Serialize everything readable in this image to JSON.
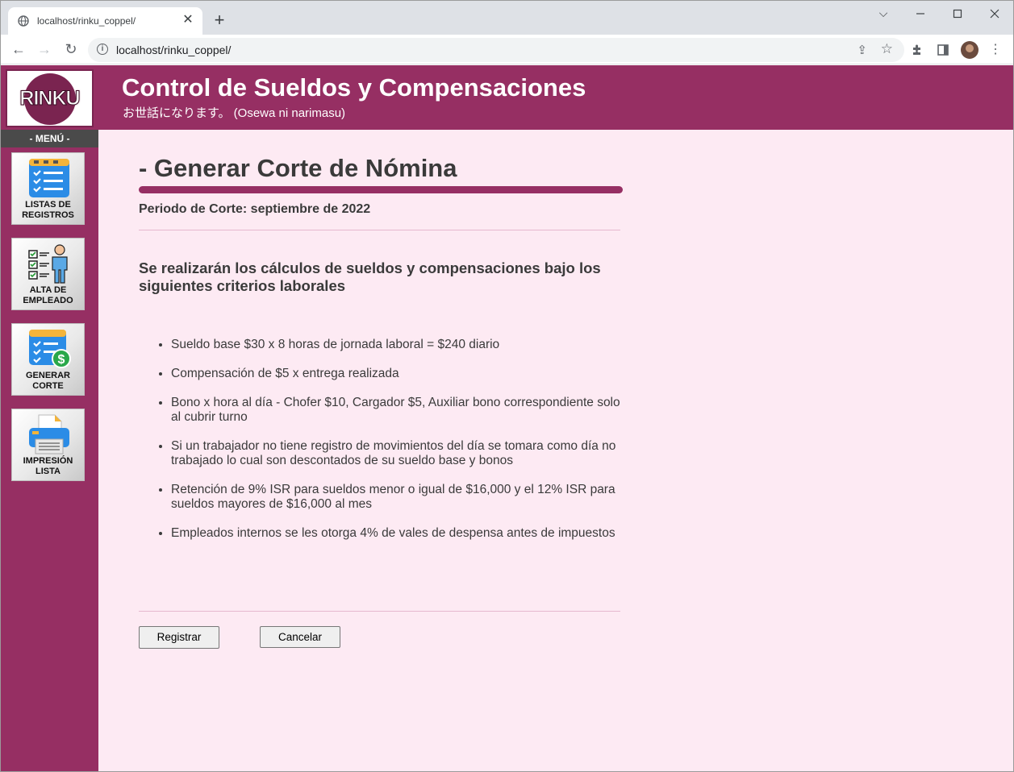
{
  "browser": {
    "tab_title": "localhost/rinku_coppel/",
    "tab_close": "✕",
    "new_tab": "+",
    "url": "localhost/rinku_coppel/",
    "window_controls": [
      "minimize",
      "maximize",
      "close"
    ]
  },
  "header": {
    "logo_text": "RINKU",
    "title": "Control de Sueldos y Compensaciones",
    "subtitle": "お世話になります。 (Osewa ni narimasu)"
  },
  "sidebar": {
    "menu_label": "- MENÚ -",
    "items": [
      {
        "label": "LISTAS DE\nREGISTROS",
        "icon": "checklist-icon"
      },
      {
        "label": "ALTA DE\nEMPLEADO",
        "icon": "employee-checklist-icon"
      },
      {
        "label": "GENERAR\nCORTE",
        "icon": "payroll-cut-icon"
      },
      {
        "label": "IMPRESIÓN\nLISTA",
        "icon": "printer-icon"
      }
    ]
  },
  "main": {
    "heading": "- Generar Corte de Nómina",
    "period": "Periodo de Corte: septiembre de 2022",
    "criteria_title": "Se realizarán los cálculos de sueldos y compensaciones bajo los siguientes criterios laborales",
    "criteria": [
      "Sueldo base $30 x 8 horas de jornada laboral = $240 diario",
      "Compensación de $5 x entrega realizada",
      "Bono x hora al día - Chofer $10, Cargador $5, Auxiliar bono correspondiente solo al cubrir turno",
      "Si un trabajador no tiene registro de movimientos del día se tomara como día no trabajado lo cual son descontados de su sueldo base y bonos",
      "Retención de 9% ISR para sueldos menor o igual de $16,000 y el 12% ISR para sueldos mayores de $16,000 al mes",
      "Empleados internos se les otorga 4% de vales de despensa antes de impuestos"
    ],
    "register_button": "Registrar",
    "cancel_button": "Cancelar"
  },
  "colors": {
    "brand": "#962f63",
    "page_bg": "#fdeaf3",
    "text": "#3a3a3a"
  }
}
